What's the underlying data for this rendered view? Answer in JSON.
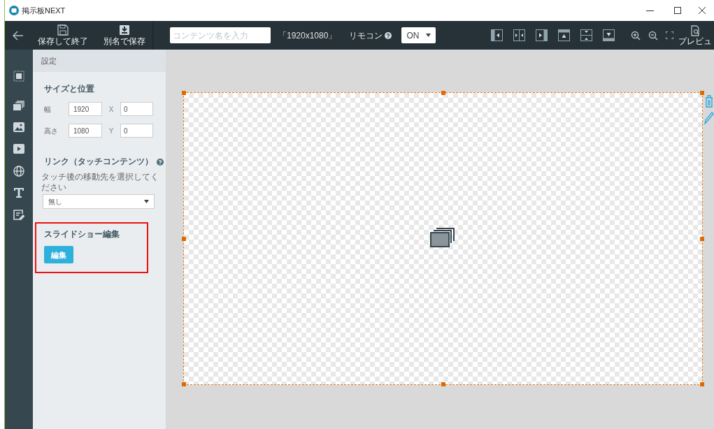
{
  "window": {
    "title": "掲示板NEXT"
  },
  "toolbar": {
    "save_buttons": [
      {
        "label": "保存して終了",
        "kind": "save"
      },
      {
        "label": "別名で保存",
        "kind": "saveas"
      }
    ],
    "content_name": {
      "placeholder": "コンテンツ名を入力"
    },
    "resolution": "「1920x1080」",
    "remote": {
      "label": "リモコン",
      "value": "ON"
    },
    "preview": {
      "label": "プレビュ"
    }
  },
  "panel": {
    "header": "設定",
    "size_section": {
      "title": "サイズと位置",
      "fields": [
        {
          "label": "幅",
          "value": "1920",
          "axis": "X",
          "axis_value": "0"
        },
        {
          "label": "高さ",
          "value": "1080",
          "axis": "Y",
          "axis_value": "0"
        }
      ]
    },
    "link_section": {
      "title": "リンク（タッチコンテンツ）",
      "hint": "タッチ後の移動先を選択してください",
      "value": "無し"
    },
    "slideshow_section": {
      "title": "スライドショー編集",
      "button": "編集",
      "highlighted": true
    }
  },
  "canvas": {
    "selected": true
  }
}
